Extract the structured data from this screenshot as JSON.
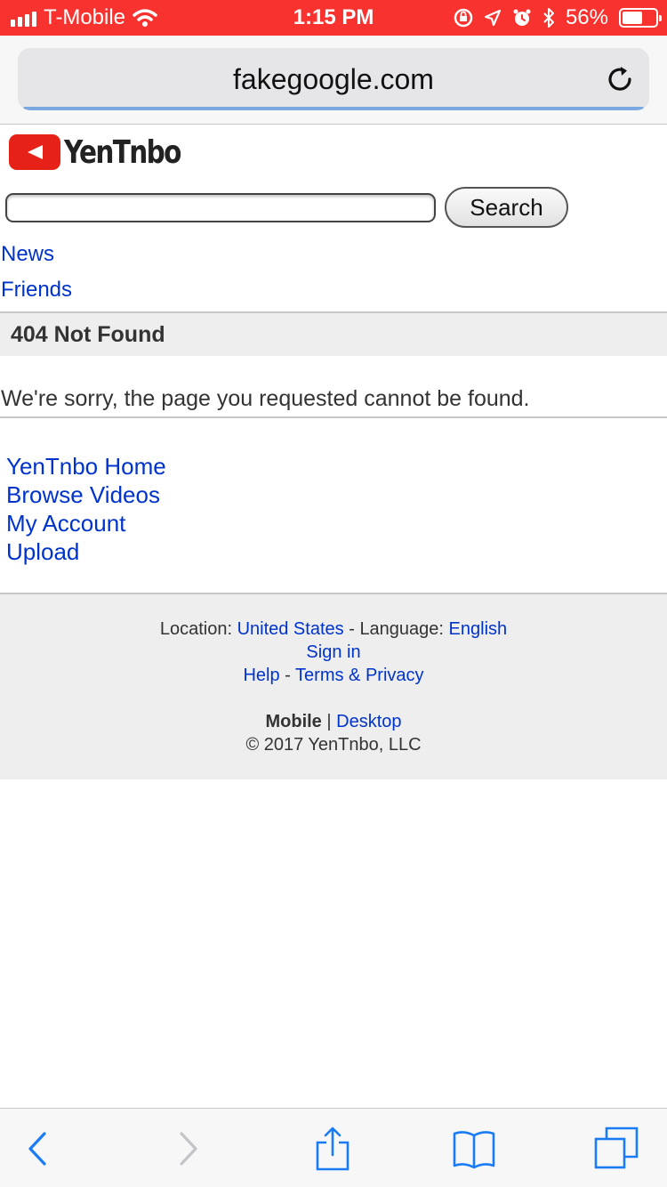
{
  "status_bar": {
    "carrier": "T-Mobile",
    "time": "1:15 PM",
    "battery": "56%",
    "battery_level": 0.56,
    "icons": [
      "signal-icon",
      "wifi-icon",
      "orientation-lock-icon",
      "location-icon",
      "alarm-icon",
      "bluetooth-icon",
      "battery-icon"
    ]
  },
  "browser": {
    "url": "fakegoogle.com",
    "reload_icon": "reload-icon"
  },
  "site": {
    "logo_text": "YenTnbo",
    "search": {
      "value": "",
      "placeholder": "",
      "button_label": "Search"
    },
    "nav": {
      "news": "News",
      "friends": "Friends"
    },
    "heading": "404 Not Found",
    "message": "We're sorry, the page you requested cannot be found.",
    "links": {
      "home": "YenTnbo Home",
      "browse": "Browse Videos",
      "account": "My Account",
      "upload": "Upload"
    }
  },
  "footer": {
    "location_label": "Location:",
    "location_value": "United States",
    "sep_dash": "-",
    "language_label": "Language:",
    "language_value": "English",
    "sign_in": "Sign in",
    "help": "Help",
    "terms": "Terms & Privacy",
    "mobile": "Mobile",
    "pipe": "|",
    "desktop": "Desktop",
    "copyright": "© 2017 YenTnbo, LLC"
  },
  "colors": {
    "status_bar_bg": "#f8332f",
    "link": "#0033cc",
    "logo_red": "#e62117",
    "ios_blue": "#1a7cf5"
  },
  "toolbar": {
    "icons": [
      "back-icon",
      "forward-icon",
      "share-icon",
      "bookmarks-icon",
      "tabs-icon"
    ]
  }
}
